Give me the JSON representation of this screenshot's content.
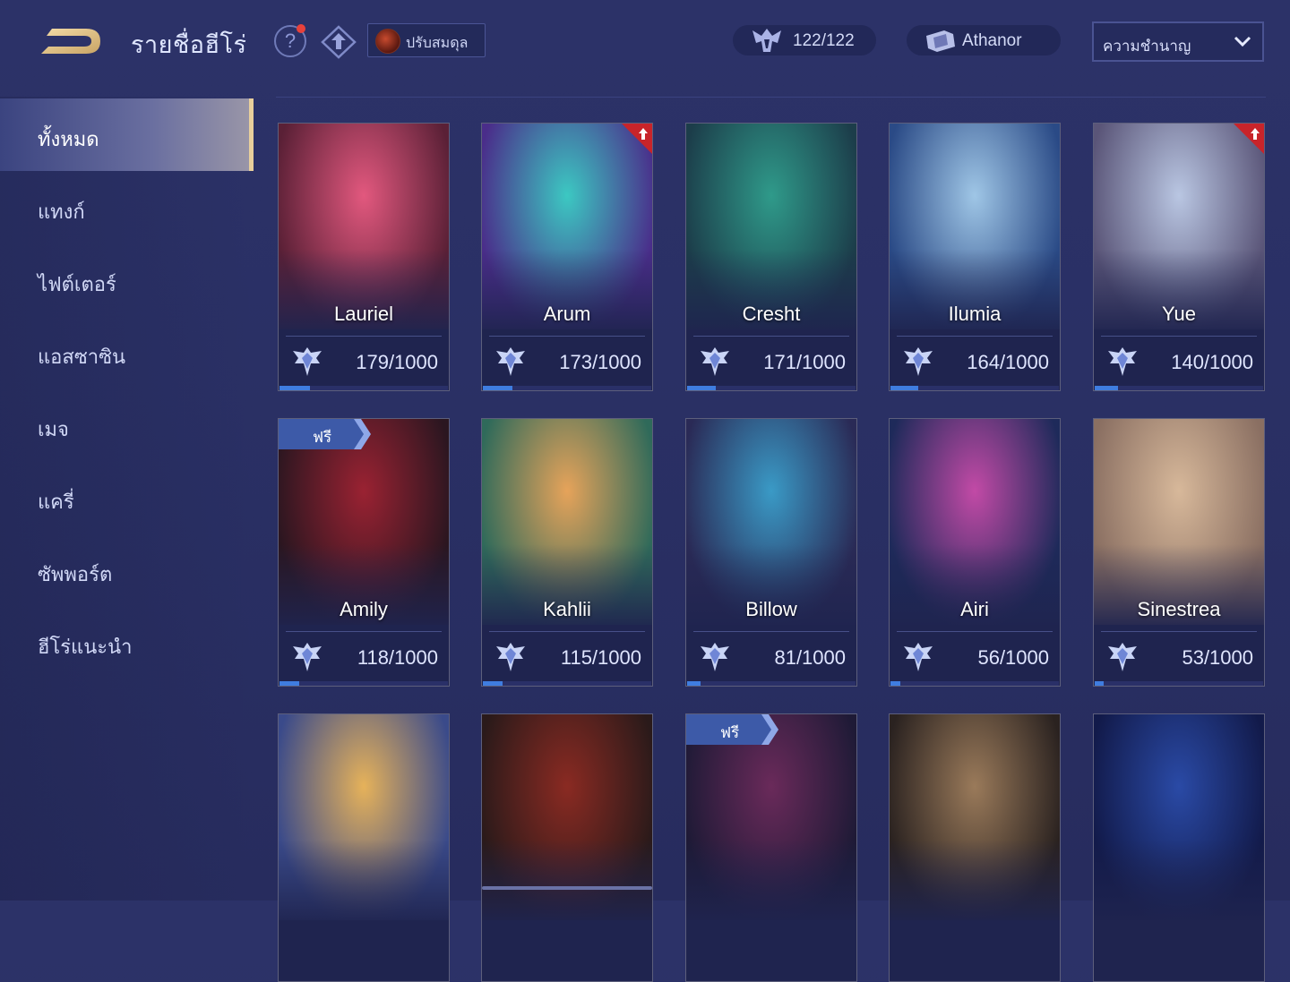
{
  "header": {
    "title": "รายชื่อฮีโร่",
    "adjust_label": "ปรับสมดุล",
    "heroes_count": "122/122",
    "athanor_label": "Athanor",
    "sort_selected": "ความชำนาญ"
  },
  "sidebar": {
    "items": [
      {
        "label": "ทั้งหมด",
        "active": true
      },
      {
        "label": "แทงก์",
        "active": false
      },
      {
        "label": "ไฟต์เตอร์",
        "active": false
      },
      {
        "label": "แอสซาซิน",
        "active": false
      },
      {
        "label": "เมจ",
        "active": false
      },
      {
        "label": "แครี่",
        "active": false
      },
      {
        "label": "ซัพพอร์ต",
        "active": false
      },
      {
        "label": "ฮีโร่แนะนำ",
        "active": false
      }
    ]
  },
  "free_tag_label": "ฟรี",
  "heroes": [
    {
      "name": "Lauriel",
      "mastery": "179/1000",
      "progress": 0.179,
      "free": false,
      "upgrade": false,
      "colors": [
        "#e2587e",
        "#5a2036"
      ]
    },
    {
      "name": "Arum",
      "mastery": "173/1000",
      "progress": 0.173,
      "free": false,
      "upgrade": true,
      "colors": [
        "#3cc8c2",
        "#4a2d8a"
      ]
    },
    {
      "name": "Cresht",
      "mastery": "171/1000",
      "progress": 0.171,
      "free": false,
      "upgrade": false,
      "colors": [
        "#2f9a8a",
        "#1c3d4a"
      ]
    },
    {
      "name": "Ilumia",
      "mastery": "164/1000",
      "progress": 0.164,
      "free": false,
      "upgrade": false,
      "colors": [
        "#9fc6e6",
        "#2a4a86"
      ]
    },
    {
      "name": "Yue",
      "mastery": "140/1000",
      "progress": 0.14,
      "free": false,
      "upgrade": true,
      "colors": [
        "#b9c6e2",
        "#5a5578"
      ]
    },
    {
      "name": "Amily",
      "mastery": "118/1000",
      "progress": 0.118,
      "free": true,
      "upgrade": false,
      "colors": [
        "#9a2232",
        "#2a1620"
      ]
    },
    {
      "name": "Kahlii",
      "mastery": "115/1000",
      "progress": 0.115,
      "free": false,
      "upgrade": false,
      "colors": [
        "#e6a35a",
        "#2f6a5a"
      ]
    },
    {
      "name": "Billow",
      "mastery": "81/1000",
      "progress": 0.081,
      "free": false,
      "upgrade": false,
      "colors": [
        "#3a9ac6",
        "#2a2a56"
      ]
    },
    {
      "name": "Airi",
      "mastery": "56/1000",
      "progress": 0.056,
      "free": false,
      "upgrade": false,
      "colors": [
        "#c24aa6",
        "#1e2a5a"
      ]
    },
    {
      "name": "Sinestrea",
      "mastery": "53/1000",
      "progress": 0.053,
      "free": false,
      "upgrade": false,
      "colors": [
        "#d7b89a",
        "#8a6f62"
      ]
    },
    {
      "name": "",
      "mastery": "",
      "progress": 0,
      "free": false,
      "upgrade": false,
      "colors": [
        "#e6b25a",
        "#3a4a8a"
      ]
    },
    {
      "name": "",
      "mastery": "",
      "progress": 0,
      "free": false,
      "upgrade": false,
      "colors": [
        "#8a2a22",
        "#2a1a1a"
      ]
    },
    {
      "name": "",
      "mastery": "",
      "progress": 0,
      "free": true,
      "upgrade": false,
      "colors": [
        "#6a2a5a",
        "#1e1a36"
      ]
    },
    {
      "name": "",
      "mastery": "",
      "progress": 0,
      "free": false,
      "upgrade": false,
      "colors": [
        "#9a7a5a",
        "#2a2220"
      ]
    },
    {
      "name": "",
      "mastery": "",
      "progress": 0,
      "free": false,
      "upgrade": false,
      "colors": [
        "#2a4aa6",
        "#121a4a"
      ]
    }
  ],
  "colors": {
    "accent_gold": "#e8cf9c",
    "progress_blue": "#3f7de0",
    "background": "#2c3268"
  }
}
